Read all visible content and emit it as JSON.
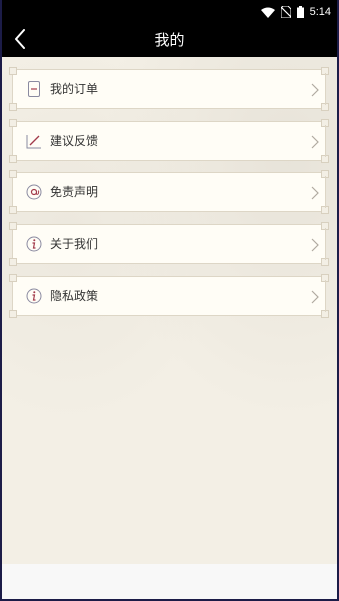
{
  "status_bar": {
    "time": "5:14",
    "icons": [
      "wifi-icon",
      "no-sim-icon",
      "battery-icon"
    ]
  },
  "header": {
    "title": "我的",
    "back_icon": "back-arrow-icon"
  },
  "menu": {
    "items": [
      {
        "label": "我的订单",
        "icon": "order-icon"
      },
      {
        "label": "建议反馈",
        "icon": "feedback-icon"
      },
      {
        "label": "免责声明",
        "icon": "disclaimer-icon"
      },
      {
        "label": "关于我们",
        "icon": "info-icon"
      },
      {
        "label": "隐私政策",
        "icon": "info-icon"
      }
    ]
  },
  "colors": {
    "header_bg": "#000000",
    "content_bg": "#f3efe5",
    "item_bg": "#fffdf6",
    "accent": "#a23a4a"
  }
}
